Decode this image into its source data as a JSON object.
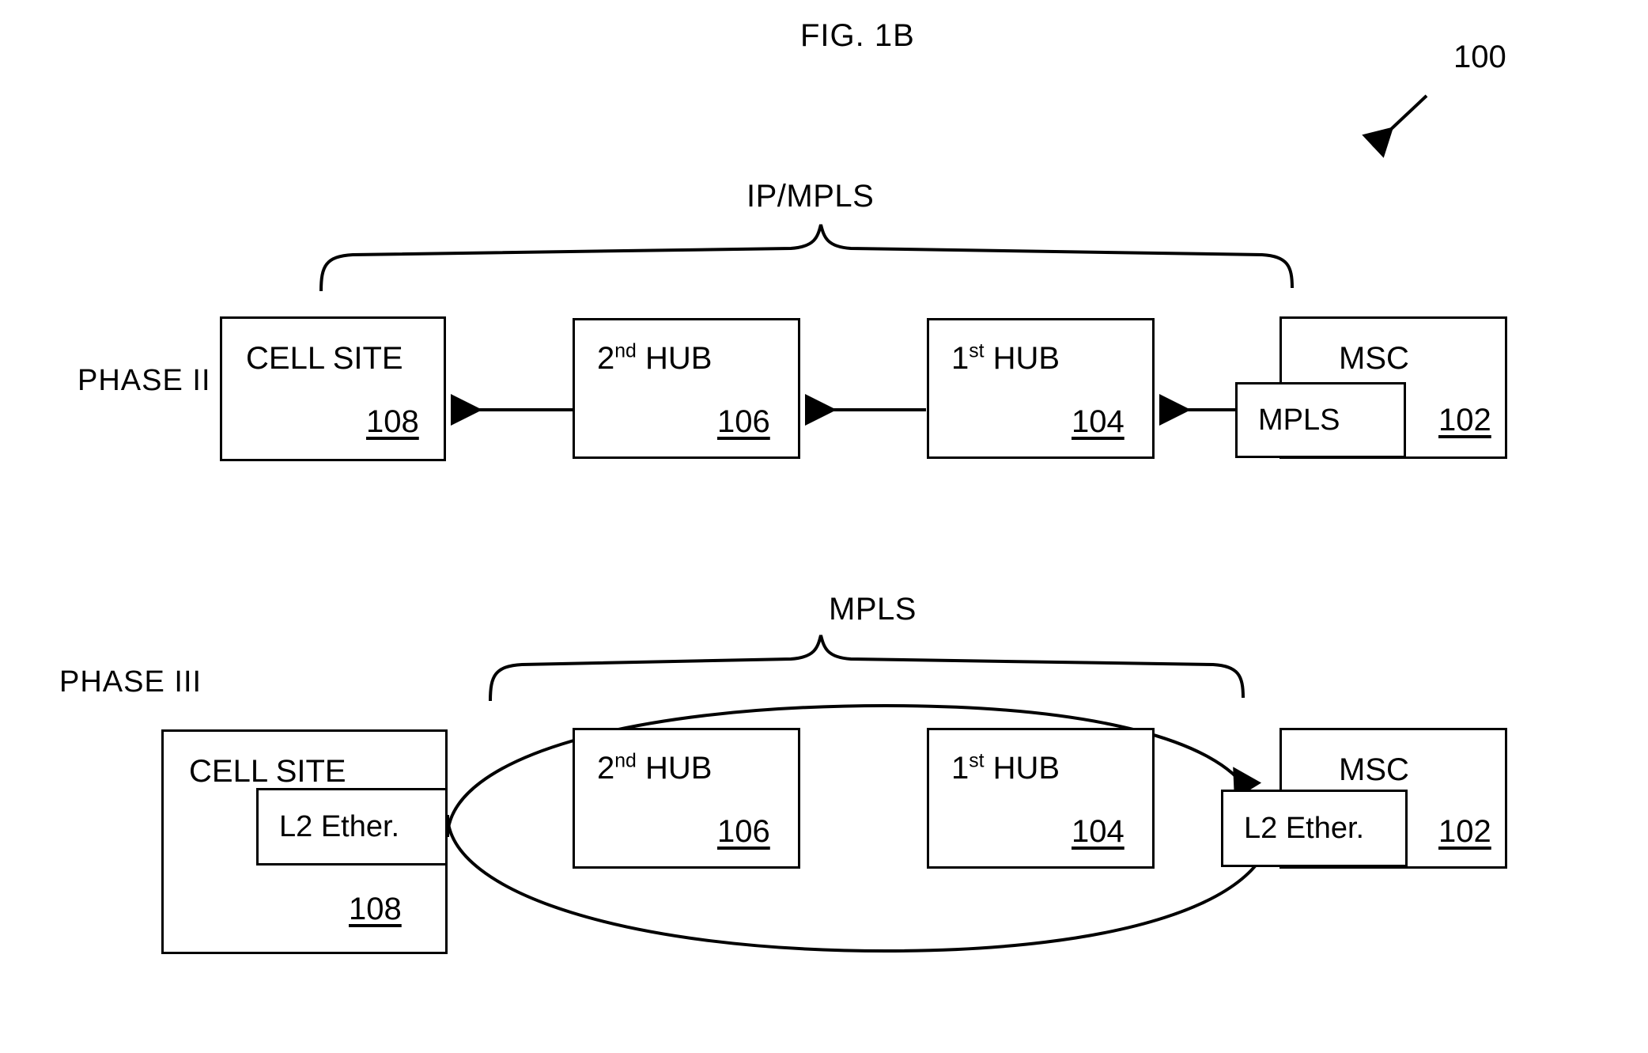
{
  "figure": {
    "title": "FIG. 1B",
    "system_reference": "100"
  },
  "phases": [
    {
      "id": "phase-2",
      "label": "PHASE II",
      "brace_label": "IP/MPLS",
      "nodes": [
        {
          "id": "cell-site",
          "title": "CELL SITE",
          "ref": "108",
          "sub_label": null
        },
        {
          "id": "second-hub",
          "title_prefix": "2",
          "title_sup": "nd",
          "title_suffix": " HUB",
          "ref": "106",
          "sub_label": null
        },
        {
          "id": "first-hub",
          "title_prefix": "1",
          "title_sup": "st",
          "title_suffix": " HUB",
          "ref": "104",
          "sub_label": null
        },
        {
          "id": "msc",
          "title": "MSC",
          "ref": "102",
          "sub_label": "MPLS"
        }
      ],
      "connector_type": "arrows-left"
    },
    {
      "id": "phase-3",
      "label": "PHASE III",
      "brace_label": "MPLS",
      "nodes": [
        {
          "id": "cell-site",
          "title": "CELL SITE",
          "ref": "108",
          "sub_label": "L2 Ether."
        },
        {
          "id": "second-hub",
          "title_prefix": "2",
          "title_sup": "nd",
          "title_suffix": " HUB",
          "ref": "106",
          "sub_label": null
        },
        {
          "id": "first-hub",
          "title_prefix": "1",
          "title_sup": "st",
          "title_suffix": " HUB",
          "ref": "104",
          "sub_label": null
        },
        {
          "id": "msc",
          "title": "MSC",
          "ref": "102",
          "sub_label": "L2 Ether."
        }
      ],
      "connector_type": "ellipse-tunnel"
    }
  ],
  "style": {
    "line_color": "#000000",
    "background": "#ffffff"
  }
}
